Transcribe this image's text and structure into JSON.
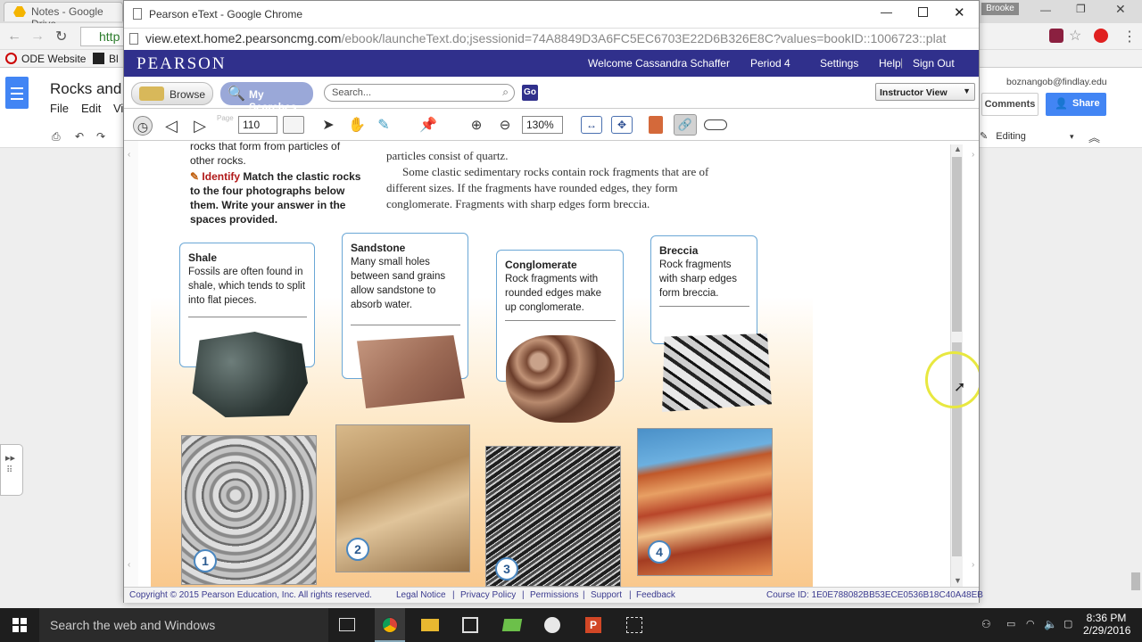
{
  "bg": {
    "tab_label": "Notes - Google Drive",
    "user_badge": "Brooke",
    "bookmarks": [
      "ODE Website",
      "Bl"
    ],
    "doc_title": "Rocks and",
    "menu": [
      "File",
      "Edit",
      "Vi"
    ],
    "account": "boznangob@findlay.edu",
    "comments": "Comments",
    "share": "Share",
    "editing": "Editing",
    "addr_fragment": "http"
  },
  "popup": {
    "window_title": "Pearson eText - Google Chrome",
    "url_host": "view.etext.home2.pearsoncmg.com",
    "url_path": "/ebook/launcheText.do;jsessionid=74A8849D3A6FC5EC6703E22D6B326E8C?values=bookID::1006723::plat"
  },
  "pearson": {
    "logo": "PEARSON",
    "welcome": "Welcome Cassandra Schaffer",
    "period": "Period 4",
    "settings": "Settings",
    "help": "Help",
    "sign_out": "Sign Out",
    "browse": "Browse",
    "my_searches": "My Searches",
    "search_placeholder": "Search...",
    "go": "Go",
    "view_select": "Instructor View",
    "page_label": "Page",
    "page_number": "110",
    "zoom": "130%"
  },
  "book": {
    "left_top": "rocks that form from particles of other rocks.",
    "identify_label": "Identify",
    "identify_text": "Match the clastic rocks to the four photographs below them. Write your answer in the spaces provided.",
    "right_line1": "particles consist of quartz.",
    "right_para": "Some clastic sedimentary rocks contain rock fragments that are of different sizes. If the fragments have rounded edges, they form conglomerate. Fragments with sharp edges form breccia.",
    "cards": [
      {
        "title": "Shale",
        "text": "Fossils are often found in shale, which tends to split into flat pieces."
      },
      {
        "title": "Sandstone",
        "text": "Many small holes between sand grains allow sandstone to absorb water."
      },
      {
        "title": "Conglomerate",
        "text": "Rock fragments with rounded edges make up conglomerate."
      },
      {
        "title": "Breccia",
        "text": "Rock fragments with sharp edges form breccia."
      }
    ],
    "photo_numbers": [
      "1",
      "2",
      "3",
      "4"
    ]
  },
  "footer": {
    "copyright": "Copyright © 2015 Pearson Education, Inc. All rights reserved.",
    "links": [
      "Legal Notice",
      "Privacy Policy",
      "Permissions",
      "Support",
      "Feedback"
    ],
    "course": "Course ID: 1E0E788082BB53ECE0536B18C40A48EB"
  },
  "taskbar": {
    "search": "Search the web and Windows",
    "time": "8:36 PM",
    "date": "2/29/2016"
  }
}
